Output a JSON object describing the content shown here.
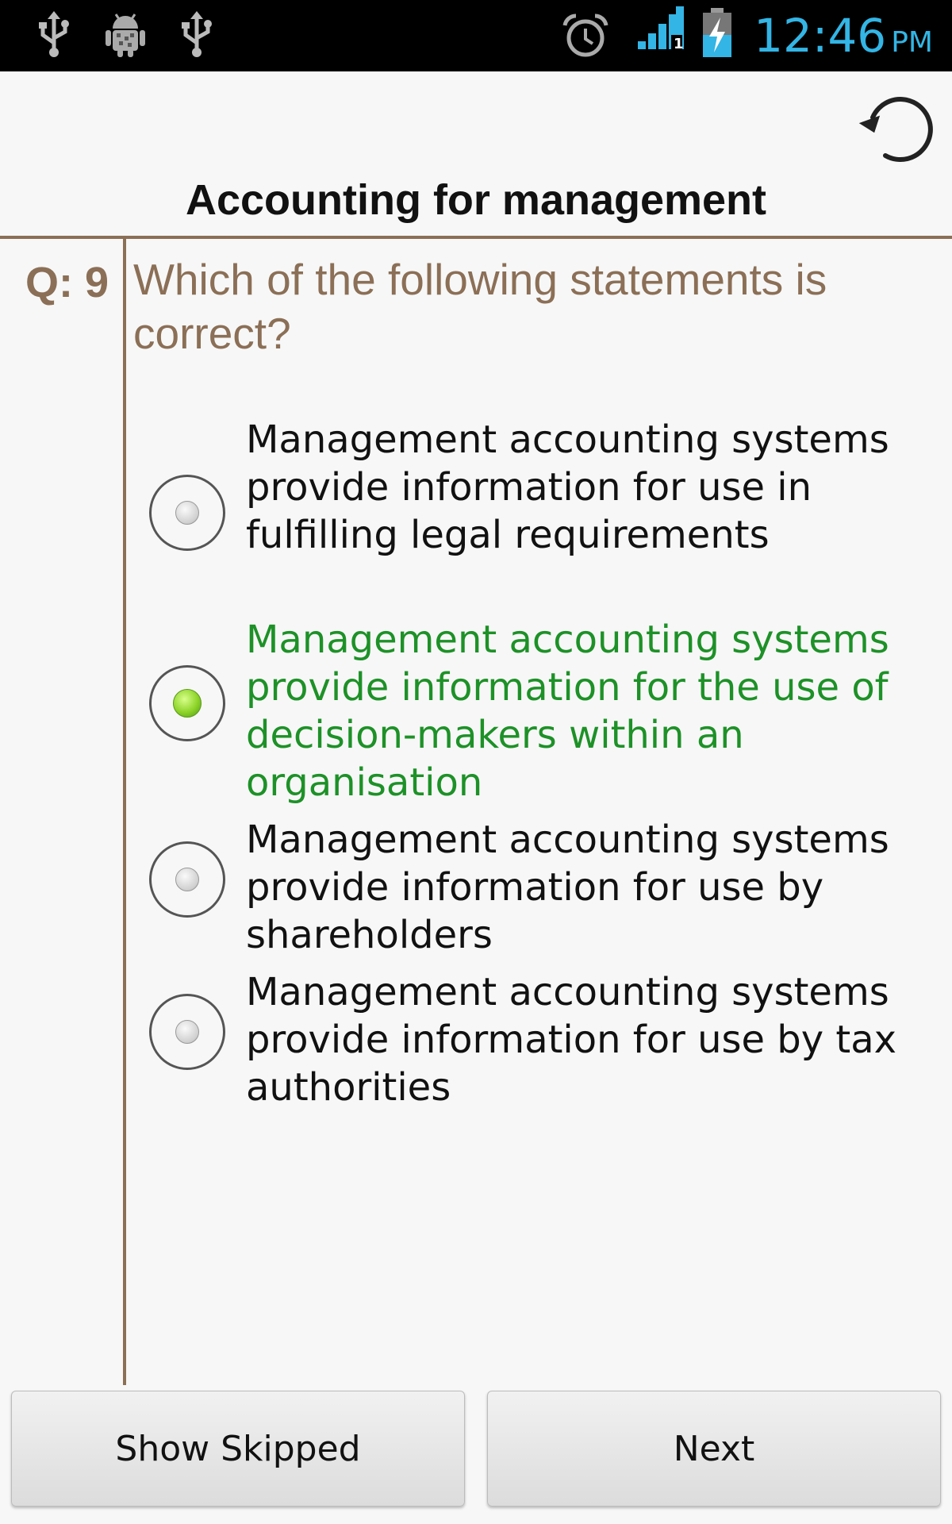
{
  "status_bar": {
    "icons": [
      "usb-icon",
      "android-debug-icon",
      "usb-icon",
      "alarm-icon",
      "signal-icon",
      "battery-charging-icon"
    ],
    "time": "12:46",
    "ampm": "PM",
    "clock_color": "#33b5e5"
  },
  "header": {
    "refresh_icon": "refresh-icon",
    "title": "Accounting for management"
  },
  "question": {
    "label": "Q: 9",
    "text": "Which of the following statements is correct?"
  },
  "options": [
    {
      "text": "Management accounting systems provide information for use in fulfilling legal requirements",
      "selected": false
    },
    {
      "text": "Management accounting systems provide information for the use of decision-makers within an organisation",
      "selected": true
    },
    {
      "text": "Management accounting systems provide information for use by shareholders",
      "selected": false
    },
    {
      "text": "Management accounting systems provide information for use by tax authorities",
      "selected": false
    }
  ],
  "buttons": {
    "show_skipped": "Show Skipped",
    "next": "Next"
  },
  "colors": {
    "accent_brown": "#8b6f56",
    "selected_green": "#1d9127",
    "status_blue": "#33b5e5"
  }
}
